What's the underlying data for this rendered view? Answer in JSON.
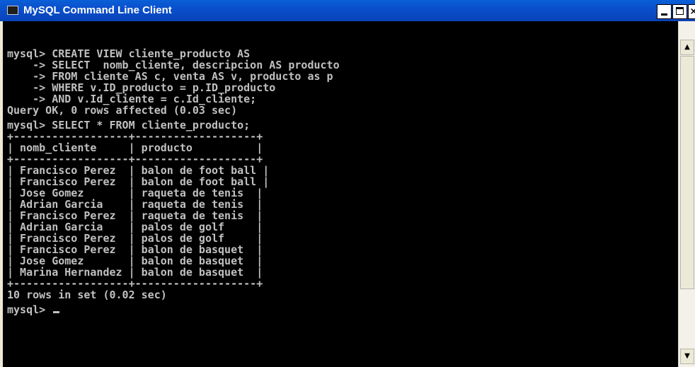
{
  "window": {
    "title": "MySQL Command Line Client",
    "icon_label": "MySQL",
    "controls": {
      "minimize_icon": "minimize-icon",
      "maximize_icon": "maximize-icon",
      "close_icon": "close-icon",
      "close_glyph": "×"
    }
  },
  "console": {
    "create_view_block": [
      "mysql> CREATE VIEW cliente_producto AS",
      "    -> SELECT  nomb_cliente, descripcion AS producto",
      "    -> FROM cliente AS c, venta AS v, producto as p",
      "    -> WHERE v.ID_producto = p.ID_producto",
      "    -> AND v.Id_cliente = c.Id_cliente;",
      "Query OK, 0 rows affected (0.03 sec)"
    ],
    "select_command": "mysql> SELECT * FROM cliente_producto;",
    "table": {
      "border": "+------------------+-------------------+",
      "header_line": "| nomb_cliente     | producto          |",
      "columns": [
        "nomb_cliente",
        "producto"
      ],
      "rows": [
        "| Francisco Perez  | balon de foot ball |",
        "| Francisco Perez  | balon de foot ball |",
        "| Jose Gomez       | raqueta de tenis  |",
        "| Adrian Garcia    | raqueta de tenis  |",
        "| Francisco Perez  | raqueta de tenis  |",
        "| Adrian Garcia    | palos de golf     |",
        "| Francisco Perez  | palos de golf     |",
        "| Francisco Perez  | balon de basquet  |",
        "| Jose Gomez       | balon de basquet  |",
        "| Marina Hernandez | balon de basquet  |"
      ]
    },
    "result_summary": "10 rows in set (0.02 sec)",
    "prompt": "mysql> "
  },
  "colors": {
    "console_background": "#000000",
    "console_text": "#c0c0c0",
    "titlebar": "#0a4fcc"
  },
  "scrollbar": {
    "up_icon": "scroll-up-arrow-icon",
    "down_icon": "scroll-down-arrow-icon",
    "up_glyph": "▲",
    "down_glyph": "▼"
  }
}
